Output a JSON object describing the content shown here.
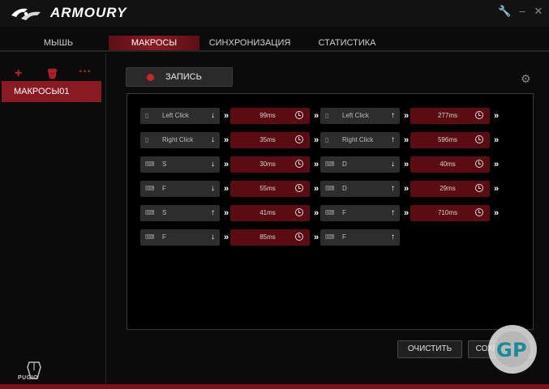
{
  "app": {
    "title": "ARMOURY"
  },
  "window": {
    "buttons": [
      "wrench-icon",
      "minimize-icon",
      "close-icon"
    ]
  },
  "tabs": [
    {
      "label": "МЫШЬ",
      "active": false
    },
    {
      "label": "МАКРОСЫ",
      "active": true
    },
    {
      "label": "СИНХРОНИЗАЦИЯ",
      "active": false
    },
    {
      "label": "СТАТИСТИКА",
      "active": false
    }
  ],
  "sidebar": {
    "actions": [
      "add-icon",
      "delete-icon",
      "more-icon"
    ],
    "items": [
      {
        "label": "МАКРОСЫ01",
        "selected": true
      }
    ]
  },
  "record": {
    "label": "ЗАПИСЬ"
  },
  "macro": {
    "rows": [
      {
        "a_key": "Left Click",
        "a_icon": "mouse-icon",
        "a_dir": "down",
        "a_delay": "99ms",
        "b_key": "Left Click",
        "b_icon": "mouse-icon",
        "b_dir": "up",
        "b_delay": "277ms"
      },
      {
        "a_key": "Right Click",
        "a_icon": "mouse-icon",
        "a_dir": "down",
        "a_delay": "35ms",
        "b_key": "Right Click",
        "b_icon": "mouse-icon",
        "b_dir": "up",
        "b_delay": "596ms"
      },
      {
        "a_key": "S",
        "a_icon": "keyboard-icon",
        "a_dir": "down",
        "a_delay": "30ms",
        "b_key": "D",
        "b_icon": "keyboard-icon",
        "b_dir": "down",
        "b_delay": "40ms"
      },
      {
        "a_key": "F",
        "a_icon": "keyboard-icon",
        "a_dir": "down",
        "a_delay": "55ms",
        "b_key": "D",
        "b_icon": "keyboard-icon",
        "b_dir": "up",
        "b_delay": "29ms"
      },
      {
        "a_key": "S",
        "a_icon": "keyboard-icon",
        "a_dir": "up",
        "a_delay": "41ms",
        "b_key": "F",
        "b_icon": "keyboard-icon",
        "b_dir": "up",
        "b_delay": "710ms"
      },
      {
        "a_key": "F",
        "a_icon": "keyboard-icon",
        "a_dir": "down",
        "a_delay": "85ms",
        "b_key": "F",
        "b_icon": "keyboard-icon",
        "b_dir": "up",
        "b_delay": ""
      }
    ]
  },
  "buttons": {
    "clear": "ОЧИСТИТЬ",
    "save": "СОХРАНИТЬ"
  },
  "device": {
    "name": "PUGIO"
  },
  "colors": {
    "accent": "#8a1a22",
    "delay_bg": "#5a0c12",
    "key_bg": "#2d2d2d"
  }
}
